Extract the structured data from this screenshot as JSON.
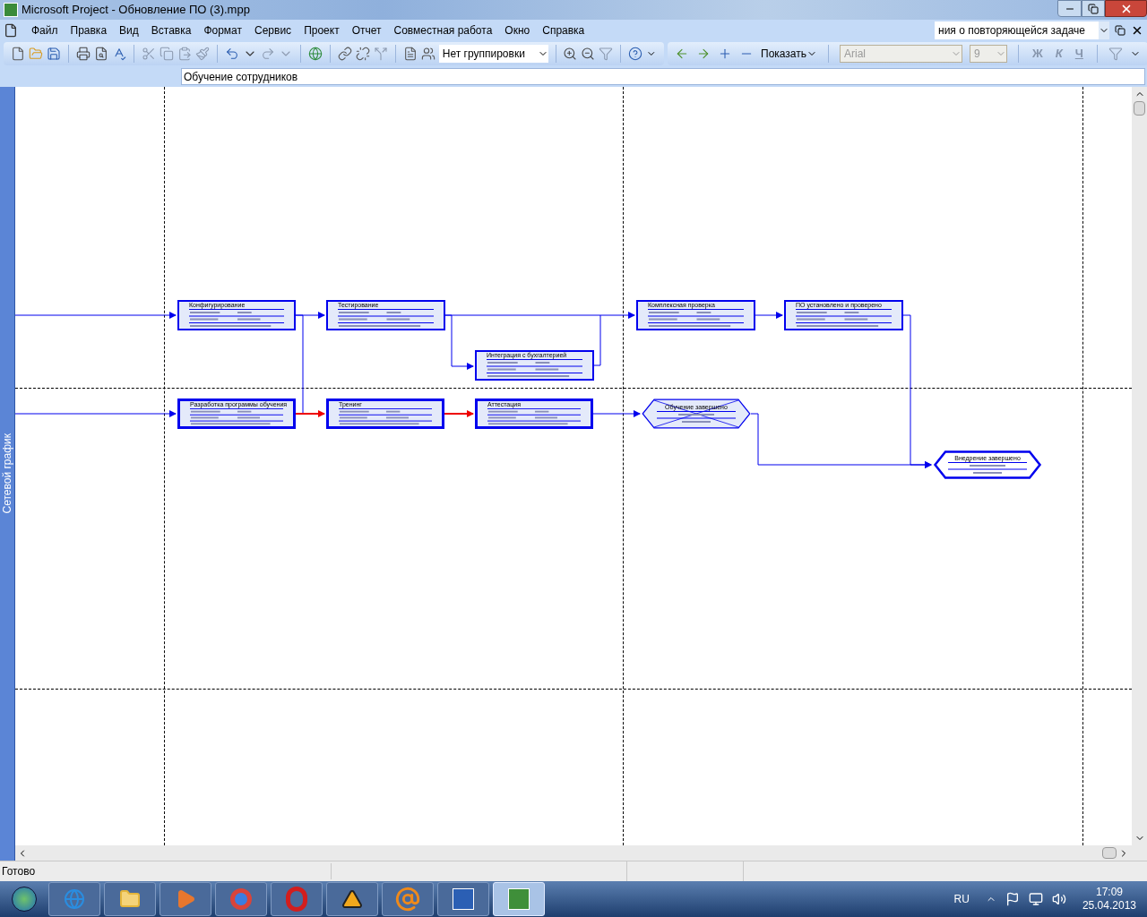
{
  "window": {
    "title": "Microsoft Project - Обновление ПО (3).mpp"
  },
  "menu": [
    "Файл",
    "Правка",
    "Вид",
    "Вставка",
    "Формат",
    "Сервис",
    "Проект",
    "Отчет",
    "Совместная работа",
    "Окно",
    "Справка"
  ],
  "question_box": {
    "value": "ния о повторяющейся задаче"
  },
  "toolbar": {
    "grouping": "Нет группировки",
    "show": "Показать",
    "font": {
      "value": "Arial",
      "disabled": true
    },
    "font_size": {
      "value": "9",
      "disabled": true
    },
    "format_buttons": [
      "Ж",
      "К",
      "Ч"
    ]
  },
  "entry_bar": {
    "value": "Обучение сотрудников"
  },
  "view_bar": {
    "label": "Сетевой график"
  },
  "nodes": [
    {
      "kind": "task",
      "critical": false,
      "name": "Конфигурирование"
    },
    {
      "kind": "task",
      "critical": false,
      "name": "Тестирование"
    },
    {
      "kind": "task",
      "critical": false,
      "name": "Интеграция с бухгалтерией"
    },
    {
      "kind": "task",
      "critical": false,
      "name": "Комплексная проверка"
    },
    {
      "kind": "task",
      "critical": false,
      "name": "ПО установлено и проверено"
    },
    {
      "kind": "task",
      "critical": true,
      "name": "Разработка программы обучения"
    },
    {
      "kind": "task",
      "critical": true,
      "name": "Тренинг"
    },
    {
      "kind": "task",
      "critical": true,
      "name": "Аттестация"
    },
    {
      "kind": "milestone",
      "critical": false,
      "crossed": true,
      "name": "Обучение завершено"
    },
    {
      "kind": "milestone",
      "critical": true,
      "crossed": false,
      "name": "Внедрение завершено"
    }
  ],
  "links": [
    {
      "critical": false
    },
    {
      "critical": false
    },
    {
      "critical": false
    },
    {
      "critical": false
    },
    {
      "critical": false
    },
    {
      "critical": false
    },
    {
      "critical": false
    },
    {
      "critical": false
    },
    {
      "critical": false
    },
    {
      "critical": true
    },
    {
      "critical": true
    },
    {
      "critical": false
    },
    {
      "critical": false
    }
  ],
  "status_bar": {
    "text": "Готово"
  },
  "taskbar": {
    "apps": [
      {
        "selected": false
      },
      {
        "selected": false
      },
      {
        "selected": false
      },
      {
        "selected": false
      },
      {
        "selected": false
      },
      {
        "selected": false
      },
      {
        "selected": false
      },
      {
        "selected": false
      },
      {
        "selected": true
      }
    ],
    "language": "RU",
    "time": "17:09",
    "date": "25.04.2013"
  }
}
